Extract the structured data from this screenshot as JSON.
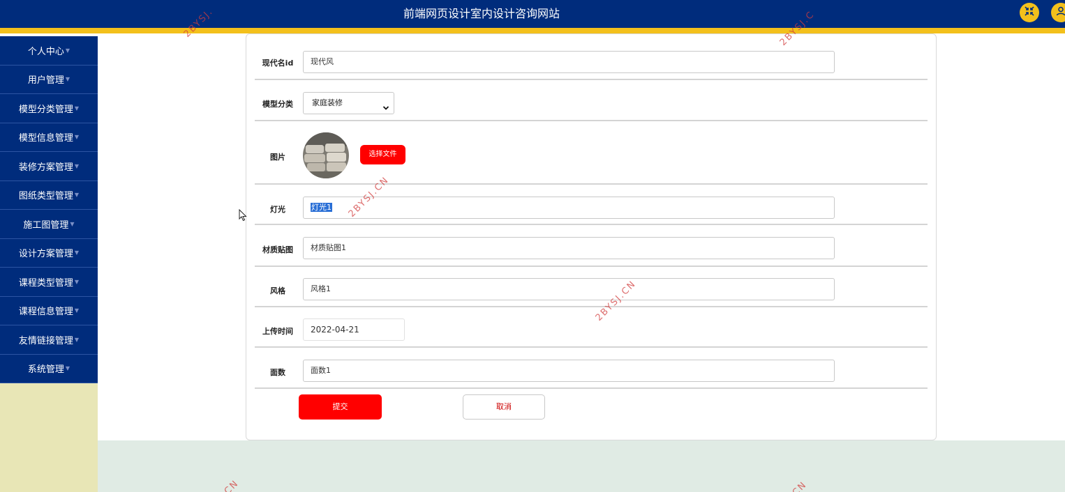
{
  "header": {
    "site_title": "前端网页设计室内设计咨询网站",
    "fullscreen_icon": "fullscreen-exit-icon",
    "user_icon": "user-icon"
  },
  "sidebar": {
    "items": [
      {
        "label": "个人中心"
      },
      {
        "label": "用户管理"
      },
      {
        "label": "模型分类管理"
      },
      {
        "label": "模型信息管理"
      },
      {
        "label": "装修方案管理"
      },
      {
        "label": "图纸类型管理"
      },
      {
        "label": "施工图管理"
      },
      {
        "label": "设计方案管理"
      },
      {
        "label": "课程类型管理"
      },
      {
        "label": "课程信息管理"
      },
      {
        "label": "友情链接管理"
      },
      {
        "label": "系统管理"
      }
    ]
  },
  "form": {
    "modern_id": {
      "label": "现代名id",
      "value": "现代风"
    },
    "model_category": {
      "label": "模型分类",
      "selected": "家庭装修"
    },
    "image": {
      "label": "图片",
      "choose_file_label": "选择文件"
    },
    "lighting": {
      "label": "灯光",
      "value": "灯光1"
    },
    "material_texture": {
      "label": "材质贴图",
      "value": "材质贴图1"
    },
    "style": {
      "label": "风格",
      "value": "风格1"
    },
    "upload_time": {
      "label": "上传时间",
      "value": "2022-04-21"
    },
    "face_count": {
      "label": "面数",
      "value": "面数1"
    },
    "submit_label": "提交",
    "cancel_label": "取消"
  },
  "watermark": {
    "text_full": "2BYSJ.CN",
    "text_a": "2BYSJ.",
    "text_b": "2BYSJ.C",
    "text_c": "CN",
    "text_d": "CN"
  },
  "colors": {
    "header_bg": "#002c7c",
    "header_strip": "#f3c01c",
    "sidebar_item_bg": "#002c7c",
    "sidebar_bg": "#e8e6b6",
    "primary_button": "#ff0000",
    "bottom_band": "#e0ebe4"
  }
}
